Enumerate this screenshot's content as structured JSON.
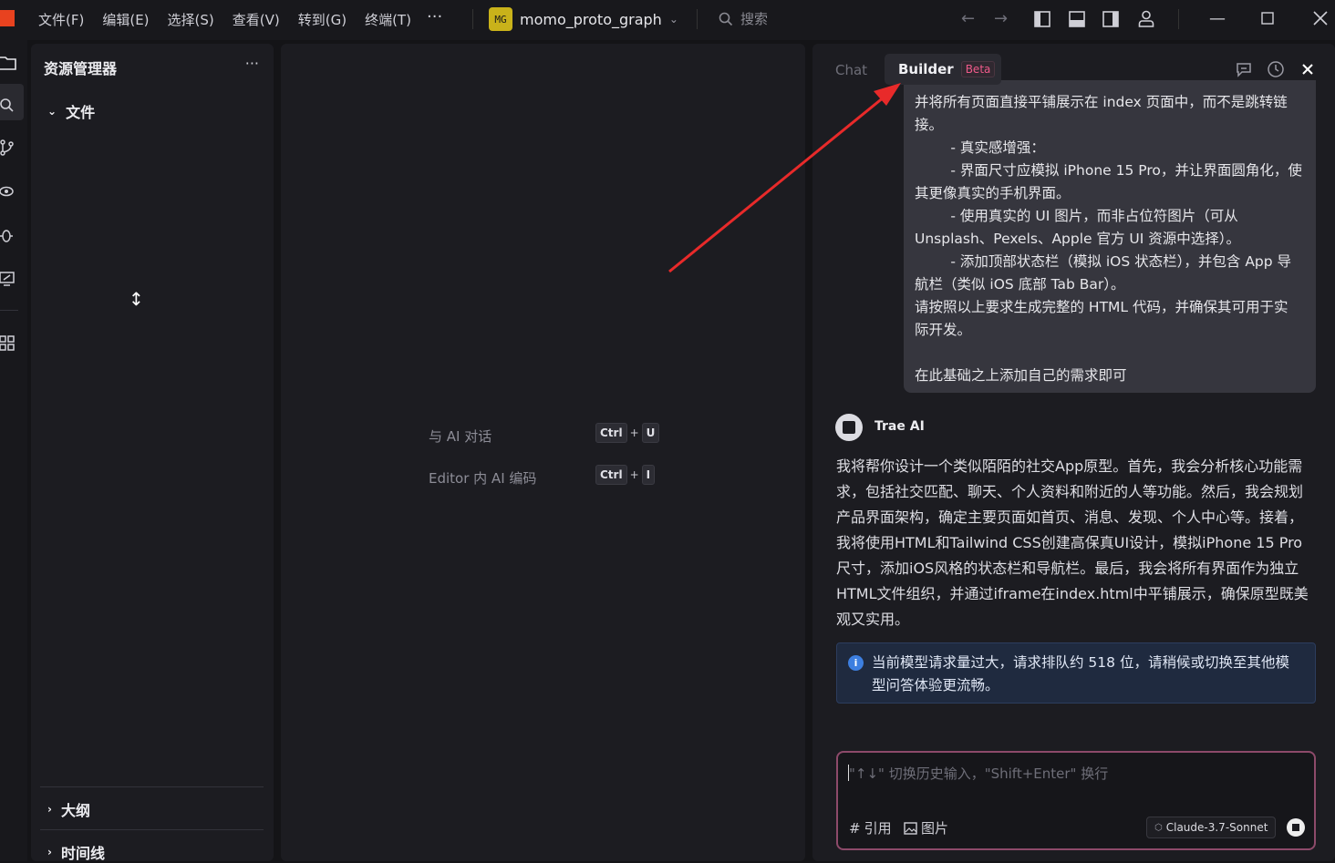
{
  "menu": {
    "items": [
      "文件(F)",
      "编辑(E)",
      "选择(S)",
      "查看(V)",
      "转到(G)",
      "终端(T)"
    ],
    "more": "···"
  },
  "project": {
    "badge": "MG",
    "name": "momo_proto_graph"
  },
  "search": {
    "label": "搜索"
  },
  "explorer": {
    "title": "资源管理器",
    "more": "···",
    "files_section": "文件",
    "outline_section": "大纲",
    "timeline_section": "时间线"
  },
  "editor": {
    "hint1": "与 AI 对话",
    "hint1_keys": [
      "Ctrl",
      "U"
    ],
    "hint2": "Editor 内 AI 编码",
    "hint2_keys": [
      "Ctrl",
      "I"
    ],
    "plus": "+"
  },
  "chat": {
    "tab_chat": "Chat",
    "tab_builder": "Builder",
    "beta": "Beta",
    "user_message": [
      "并将所有页面直接平铺展示在 index 页面中，而不是跳转链",
      "接。",
      "        - 真实感增强：",
      "        - 界面尺寸应模拟 iPhone 15 Pro，并让界面圆角化，使",
      "其更像真实的手机界面。",
      "        - 使用真实的 UI 图片，而非占位符图片（可从",
      "Unsplash、Pexels、Apple 官方 UI 资源中选择）。",
      "        - 添加顶部状态栏（模拟 iOS 状态栏），并包含 App 导",
      "航栏（类似 iOS 底部 Tab Bar）。",
      "请按照以上要求生成完整的 HTML 代码，并确保其可用于实",
      "际开发。",
      "",
      "在此基础之上添加自己的需求即可"
    ],
    "ai_name": "Trae AI",
    "ai_message": [
      "我将帮你设计一个类似陌陌的社交App原型。首先，我会分析核心功能需",
      "求，包括社交匹配、聊天、个人资料和附近的人等功能。然后，我会规划",
      "产品界面架构，确定主要页面如首页、消息、发现、个人中心等。接着，",
      "我将使用HTML和Tailwind CSS创建高保真UI设计，模拟iPhone 15 Pro",
      "尺寸，添加iOS风格的状态栏和导航栏。最后，我会将所有界面作为独立",
      "HTML文件组织，并通过iframe在index.html中平铺展示，确保原型既美",
      "观又实用。"
    ],
    "notice": [
      "当前模型请求量过大，请求排队约 518 位，请稍候或切换至其他模",
      "型问答体验更流畅。"
    ],
    "input_placeholder": "\"↑↓\" 切换历史输入，\"Shift+Enter\" 换行",
    "cite_label": "引用",
    "image_label": "图片",
    "model_label": "Claude-3.7-Sonnet"
  },
  "colors": {
    "accent_red": "#e82a2a",
    "input_border": "#8d4a6a",
    "notice_bg": "#1f2a3f"
  }
}
